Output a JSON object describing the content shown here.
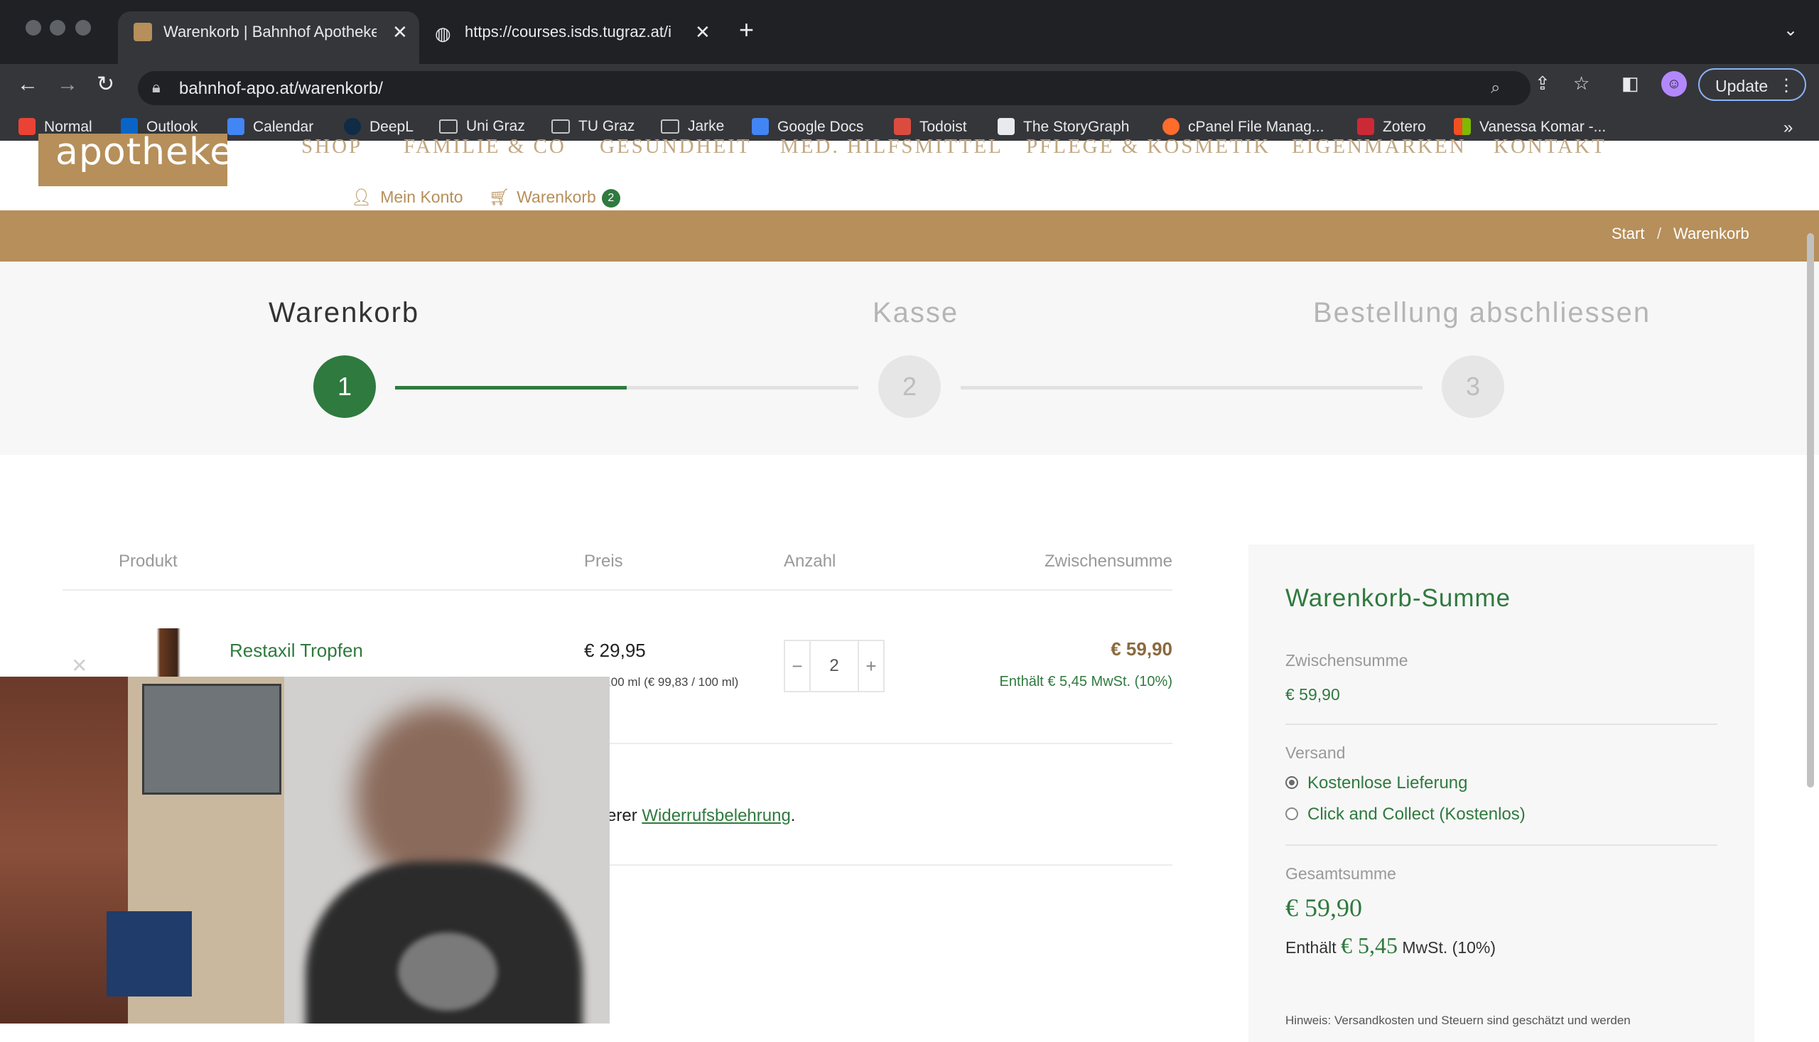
{
  "browser": {
    "tabs": [
      {
        "title": "Warenkorb | Bahnhof Apotheke",
        "active": true
      },
      {
        "title": "https://courses.isds.tugraz.at/i",
        "active": false
      }
    ],
    "url": "bahnhof-apo.at/warenkorb/",
    "update_label": "Update",
    "bookmarks": [
      {
        "label": "Normal",
        "icon": "gmail-icon"
      },
      {
        "label": "Outlook",
        "icon": "outlook-icon"
      },
      {
        "label": "Calendar",
        "icon": "calendar-icon"
      },
      {
        "label": "DeepL",
        "icon": "deepl-icon"
      },
      {
        "label": "Uni Graz",
        "icon": "folder-icon"
      },
      {
        "label": "TU Graz",
        "icon": "folder-icon"
      },
      {
        "label": "Jarke",
        "icon": "folder-icon"
      },
      {
        "label": "Google Docs",
        "icon": "docs-icon"
      },
      {
        "label": "Todoist",
        "icon": "todoist-icon"
      },
      {
        "label": "The StoryGraph",
        "icon": "storygraph-icon"
      },
      {
        "label": "cPanel File Manag...",
        "icon": "cpanel-icon"
      },
      {
        "label": "Zotero",
        "icon": "zotero-icon"
      },
      {
        "label": "Vanessa Komar -...",
        "icon": "windows-icon"
      }
    ]
  },
  "site": {
    "logo_text": "apotheke",
    "nav": [
      "SHOP",
      "FAMILIE & CO",
      "GESUNDHEIT",
      "MED. HILFSMITTEL",
      "PFLEGE & KOSMETIK",
      "EIGENMARKEN",
      "KONTAKT"
    ],
    "account_label": "Mein Konto",
    "cart_label": "Warenkorb",
    "cart_count": "2",
    "breadcrumb": {
      "home": "Start",
      "sep": "/",
      "current": "Warenkorb"
    }
  },
  "steps": [
    {
      "label": "Warenkorb",
      "number": "1",
      "active": true
    },
    {
      "label": "Kasse",
      "number": "2",
      "active": false
    },
    {
      "label": "Bestellung abschliessen",
      "number": "3",
      "active": false
    }
  ],
  "step_progress": 0.5,
  "cart": {
    "headers": {
      "product": "Produkt",
      "price": "Preis",
      "quantity": "Anzahl",
      "subtotal": "Zwischensumme"
    },
    "items": [
      {
        "name": "Restaxil Tropfen",
        "price": "€ 29,95",
        "unit_info": "t: 30,00 ml (€ 99,83 / 100 ml)",
        "quantity": "2",
        "minus": "−",
        "plus": "+",
        "total": "€ 59,90",
        "tax_note": "Enthält € 5,45 MwSt. (10%)"
      }
    ],
    "widerruf_prefix": "erer ",
    "widerruf_link": "Widerrufsbelehrung",
    "widerruf_suffix": "."
  },
  "totals": {
    "title": "Warenkorb-Summe",
    "subtotal_label": "Zwischensumme",
    "subtotal_value": "€ 59,90",
    "shipping_label": "Versand",
    "shipping_options": [
      {
        "label": "Kostenlose Lieferung",
        "checked": true
      },
      {
        "label": "Click and Collect (Kostenlos)",
        "checked": false
      }
    ],
    "total_label": "Gesamtsumme",
    "total_value": "€ 59,90",
    "tax_prefix": "Enthält",
    "tax_value": "€ 5,45",
    "tax_suffix": "MwSt. (10%)",
    "hint": "Hinweis: Versandkosten und Steuern sind geschätzt und werden"
  },
  "colors": {
    "brand_gold": "#b68f5a",
    "brand_green": "#2f7a3e",
    "chrome_dark": "#202124",
    "chrome_toolbar": "#35363a"
  }
}
